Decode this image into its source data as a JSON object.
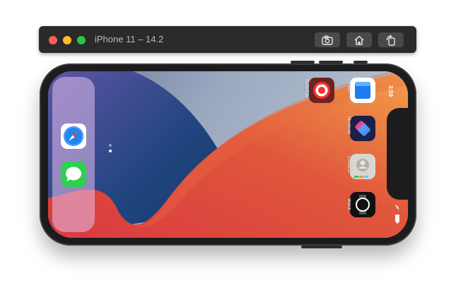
{
  "window": {
    "title": "iPhone 11 – 14.2",
    "buttons": {
      "screenshot": "camera-icon",
      "home": "home-icon",
      "rotate": "rotate-icon"
    }
  },
  "status_bar": {
    "time": "3:59"
  },
  "home_screen": {
    "apps": [
      {
        "id": "files",
        "label": "Files",
        "icon": "files-icon"
      },
      {
        "id": "bullseye",
        "label": "Bull's Eye",
        "icon": "bullseye-icon"
      },
      {
        "id": "shortcuts",
        "label": "Shortcuts",
        "icon": "shortcuts-icon"
      },
      {
        "id": "contacts",
        "label": "Contacts",
        "icon": "contacts-icon"
      },
      {
        "id": "watch",
        "label": "Watch",
        "icon": "watch-icon"
      }
    ],
    "page_dots": 2,
    "active_page": 2
  },
  "dock": {
    "apps": [
      {
        "id": "safari",
        "icon": "safari-icon"
      },
      {
        "id": "messages",
        "icon": "messages-icon"
      }
    ]
  },
  "colors": {
    "titlebar": "#2b2a2a",
    "close": "#fe5f57",
    "minimize": "#febc2e",
    "zoom": "#28c840",
    "bezel": "#1c1c1e"
  }
}
